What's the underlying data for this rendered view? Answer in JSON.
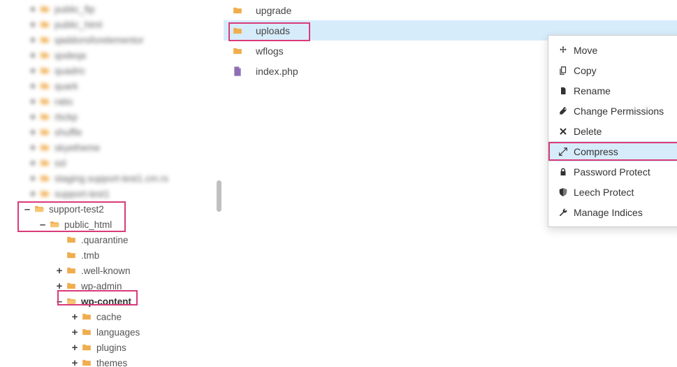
{
  "sidebar": {
    "blurred": [
      "public_ftp",
      "public_html",
      "qaddonsforelementor",
      "qodeqa",
      "quadric",
      "quark",
      "ratio",
      "rbckp",
      "shuffle",
      "skyetheme",
      "ssl",
      "staging.support-test1.cm.rs",
      "support-test1"
    ],
    "l1": {
      "toggle": "–",
      "label": "support-test2"
    },
    "l2": {
      "toggle": "–",
      "label": "public_html"
    },
    "children": [
      {
        "toggle": "",
        "label": ".quarantine"
      },
      {
        "toggle": "",
        "label": ".tmb"
      },
      {
        "toggle": "+",
        "label": ".well-known"
      },
      {
        "toggle": "+",
        "label": "wp-admin"
      },
      {
        "toggle": "–",
        "label": "wp-content",
        "bold": true,
        "open": true
      },
      {
        "toggle": "+",
        "label": "cache",
        "nest": 1
      },
      {
        "toggle": "+",
        "label": "languages",
        "nest": 1
      },
      {
        "toggle": "+",
        "label": "plugins",
        "nest": 1
      },
      {
        "toggle": "+",
        "label": "themes",
        "nest": 1
      }
    ]
  },
  "main": {
    "rows": [
      {
        "type": "folder",
        "label": "upgrade"
      },
      {
        "type": "folder",
        "label": "uploads",
        "selected": true
      },
      {
        "type": "folder",
        "label": "wflogs"
      },
      {
        "type": "php",
        "label": "index.php"
      }
    ]
  },
  "context_menu": [
    {
      "icon": "move",
      "label": "Move"
    },
    {
      "icon": "copy",
      "label": "Copy"
    },
    {
      "icon": "rename",
      "label": "Rename"
    },
    {
      "icon": "perm",
      "label": "Change Permissions"
    },
    {
      "icon": "delete",
      "label": "Delete"
    },
    {
      "icon": "compress",
      "label": "Compress",
      "hover": true
    },
    {
      "icon": "lock",
      "label": "Password Protect"
    },
    {
      "icon": "shield",
      "label": "Leech Protect"
    },
    {
      "icon": "wrench",
      "label": "Manage Indices"
    }
  ]
}
